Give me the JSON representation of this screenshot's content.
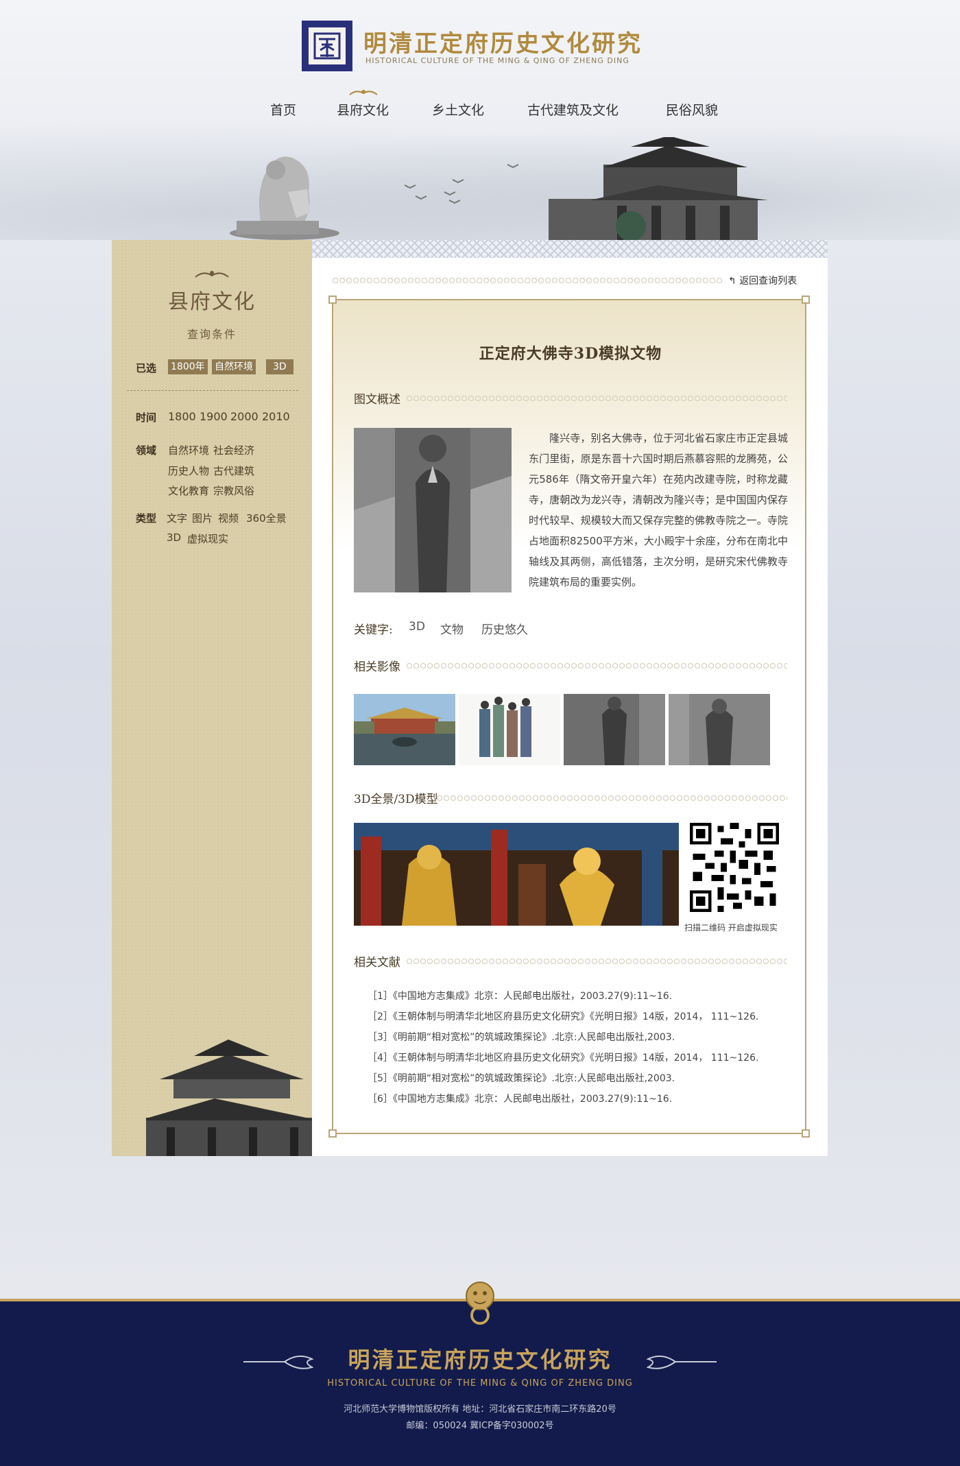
{
  "header": {
    "title": "明清正定府历史文化研究",
    "subtitle": "HISTORICAL CULTURE OF THE MING & QING OF ZHENG DING"
  },
  "nav": {
    "items": [
      {
        "label": "首页"
      },
      {
        "label": "县府文化"
      },
      {
        "label": "乡土文化"
      },
      {
        "label": "古代建筑及文化"
      },
      {
        "label": "民俗风貌"
      }
    ],
    "active": "县府文化"
  },
  "sidebar": {
    "title": "县府文化",
    "subtitle": "查询条件",
    "selected_label": "已选",
    "selected_tags": [
      "1800年",
      "自然环境",
      "3D"
    ],
    "time_label": "时间",
    "time_options": [
      "1800",
      "1900",
      "2000",
      "2010"
    ],
    "field_label": "领域",
    "field_options": [
      "自然环境",
      "社会经济",
      "历史人物",
      "古代建筑",
      "文化教育",
      "宗教风俗"
    ],
    "type_label": "类型",
    "type_options": [
      "文字",
      "图片",
      "视频",
      "360全景",
      "3D",
      "虚拟现实"
    ]
  },
  "content": {
    "back_link": "返回查询列表",
    "title": "正定府大佛寺3D模拟文物",
    "section_intro": "图文概述",
    "intro_text": "隆兴寺，别名大佛寺，位于河北省石家庄市正定县城东门里街，原是东晋十六国时期后燕慕容熙的龙腾苑，公元586年（隋文帝开皇六年）在苑内改建寺院，时称龙藏寺，唐朝改为龙兴寺，清朝改为隆兴寺；是中国国内保存时代较早、规模较大而又保存完整的佛教寺院之一。寺院占地面积82500平方米，大小殿宇十余座，分布在南北中轴线及其两侧，高低错落，主次分明，是研究宋代佛教寺院建筑布局的重要实例。",
    "keywords_label": "关键字:",
    "keywords": [
      "3D",
      "文物",
      "历史悠久"
    ],
    "section_images": "相关影像",
    "section_3d": "3D全景/3D模型",
    "qr_caption": "扫描二维码 开启虚拟现实",
    "section_refs": "相关文献",
    "references": [
      "［1］《中国地方志集成》北京：人民邮电出版社，2003.27(9):11~16.",
      "［2］《王朝体制与明清华北地区府县历史文化研究》《光明日报》14版，2014， 111~126.",
      "［3］《明前期“相对宽松”的筑城政策探论》.北京:人民邮电出版社,2003.",
      "［4］《王朝体制与明清华北地区府县历史文化研究》《光明日报》14版，2014， 111~126.",
      "［5］《明前期“相对宽松”的筑城政策探论》.北京:人民邮电出版社,2003.",
      "［6］《中国地方志集成》北京：人民邮电出版社，2003.27(9):11~16."
    ]
  },
  "footer": {
    "title": "明清正定府历史文化研究",
    "subtitle": "HISTORICAL CULTURE OF THE MING & QING OF ZHENG DING",
    "copyright": "河北师范大学博物馆版权所有 地址：河北省石家庄市南二环东路20号",
    "postal": "邮编：050024    冀ICP备字030002号"
  },
  "colors": {
    "accent_gold": "#b08a3e",
    "footer_navy": "#121b4b",
    "sidebar_tan": "#d8cda6",
    "tag_brown": "#8f7a52"
  }
}
